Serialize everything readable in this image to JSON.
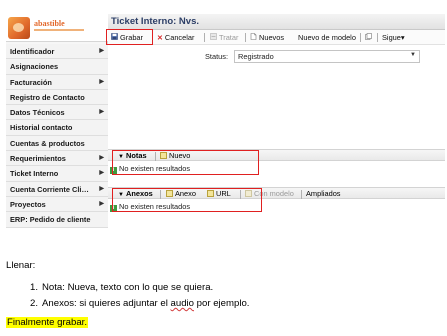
{
  "logo": {
    "text": "abastible"
  },
  "sidebar": {
    "items": [
      {
        "label": "Identificador",
        "arrow": true
      },
      {
        "label": "Asignaciones",
        "arrow": false
      },
      {
        "label": "Facturación",
        "arrow": true
      },
      {
        "label": "Registro de Contacto",
        "arrow": false
      },
      {
        "label": "Datos Técnicos",
        "arrow": true
      },
      {
        "label": "Historial contacto",
        "arrow": false
      },
      {
        "label": "Cuentas & productos",
        "arrow": false
      },
      {
        "label": "Requerimientos",
        "arrow": true
      },
      {
        "label": "Ticket Interno",
        "arrow": true
      },
      {
        "label": "Cuenta Corriente Cli…",
        "arrow": true
      },
      {
        "label": "Proyectos",
        "arrow": true
      },
      {
        "label": "ERP: Pedido de cliente",
        "arrow": false
      }
    ],
    "arrow_glyph": "▶"
  },
  "main": {
    "title": "Ticket Interno: Nvs.",
    "toolbar": {
      "save": "Grabar",
      "cancel": "Cancelar",
      "process": "Tratar",
      "new": "Nuevos",
      "new_from_template": "Nuevo de modelo",
      "next": "Sigue▾"
    },
    "status": {
      "label": "Status:",
      "value": "Registrado"
    },
    "notes": {
      "title": "Notas",
      "new_label": "Nuevo",
      "empty": "No existen resultados"
    },
    "attachments": {
      "title": "Anexos",
      "annex": "Anexo",
      "url": "URL",
      "with_model": "Con modelo",
      "extended": "Ampliados",
      "empty": "No existen resultados"
    }
  },
  "instructions": {
    "intro": "Llenar:",
    "steps": [
      {
        "num": "1.",
        "text": "Nota: Nueva, texto con lo que se quiera."
      },
      {
        "num": "2.",
        "pre": "Anexos: si quieres adjuntar el ",
        "underlined": "audio",
        "post": " por ejemplo."
      }
    ],
    "final": "Finalmente grabar."
  },
  "colors": {
    "highlight_box": "#e02020",
    "brand": "#e2672a",
    "title": "#2c3e66",
    "final_highlight": "#ffff00"
  }
}
